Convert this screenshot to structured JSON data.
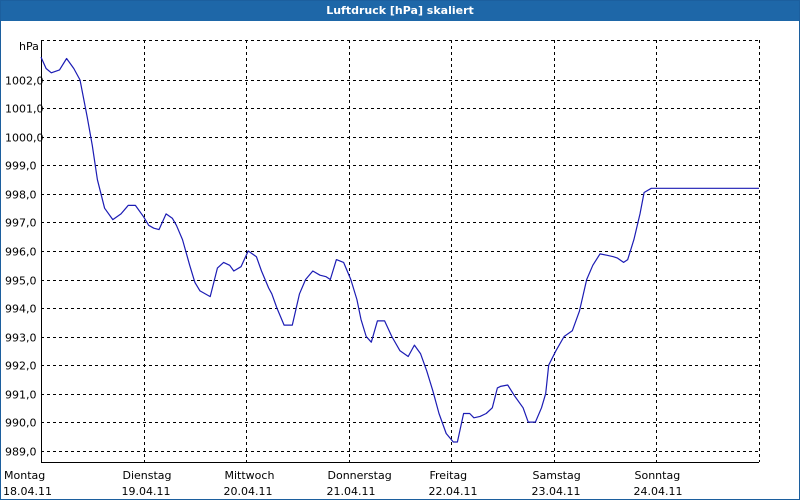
{
  "window": {
    "title": "Luftdruck [hPa] skaliert"
  },
  "chart_data": {
    "type": "line",
    "title": "Luftdruck [hPa] skaliert",
    "ylabel": "hPa",
    "xlabel": "",
    "ylim": [
      988.6,
      1003.4
    ],
    "xlim": [
      0,
      7
    ],
    "grid": true,
    "legend": "none",
    "line_color": "#1c1cb4",
    "grid_color": "#000000",
    "y_ticks": [
      "989,0",
      "990,0",
      "991,0",
      "992,0",
      "993,0",
      "994,0",
      "995,0",
      "996,0",
      "997,0",
      "998,0",
      "999,0",
      "1000,0",
      "1001,0",
      "1002,0"
    ],
    "y_tick_values": [
      989,
      990,
      991,
      992,
      993,
      994,
      995,
      996,
      997,
      998,
      999,
      1000,
      1001,
      1002
    ],
    "x_ticks": [
      {
        "x": 0,
        "day": "Montag",
        "date": "18.04.11"
      },
      {
        "x": 1,
        "day": "Dienstag",
        "date": "19.04.11"
      },
      {
        "x": 2,
        "day": "Mittwoch",
        "date": "20.04.11"
      },
      {
        "x": 3,
        "day": "Donnerstag",
        "date": "21.04.11"
      },
      {
        "x": 4,
        "day": "Freitag",
        "date": "22.04.11"
      },
      {
        "x": 5,
        "day": "Samstag",
        "date": "23.04.11"
      },
      {
        "x": 6,
        "day": "Sonntag",
        "date": "24.04.11"
      }
    ],
    "series": [
      {
        "name": "",
        "x": [
          0.0,
          0.05,
          0.1,
          0.18,
          0.25,
          0.32,
          0.38,
          0.45,
          0.5,
          0.55,
          0.62,
          0.7,
          0.78,
          0.85,
          0.92,
          1.0,
          1.05,
          1.1,
          1.15,
          1.22,
          1.28,
          1.32,
          1.38,
          1.45,
          1.5,
          1.55,
          1.65,
          1.72,
          1.78,
          1.84,
          1.88,
          1.95,
          2.02,
          2.1,
          2.15,
          2.22,
          2.25,
          2.3,
          2.37,
          2.45,
          2.52,
          2.58,
          2.65,
          2.72,
          2.78,
          2.82,
          2.88,
          2.95,
          3.02,
          3.08,
          3.12,
          3.17,
          3.22,
          3.28,
          3.35,
          3.42,
          3.5,
          3.58,
          3.64,
          3.7,
          3.76,
          3.82,
          3.88,
          3.95,
          4.02,
          4.06,
          4.12,
          4.18,
          4.22,
          4.28,
          4.34,
          4.4,
          4.45,
          4.48,
          4.55,
          4.62,
          4.7,
          4.75,
          4.82,
          4.88,
          4.92,
          4.95,
          5.02,
          5.1,
          5.18,
          5.25,
          5.32,
          5.38,
          5.45,
          5.52,
          5.58,
          5.62,
          5.68,
          5.72,
          5.78,
          5.84,
          5.88,
          5.95,
          6.02,
          6.08,
          6.12,
          6.2,
          6.28,
          6.36,
          6.44,
          6.52,
          6.6,
          6.65,
          6.7,
          6.75,
          6.82,
          6.88,
          6.92,
          6.95,
          7.0
        ],
        "values": [
          1002.8,
          1002.4,
          1002.25,
          1002.35,
          1002.75,
          1002.4,
          1002.0,
          1000.7,
          999.7,
          998.5,
          997.5,
          997.1,
          997.3,
          997.6,
          997.6,
          997.2,
          996.9,
          996.8,
          996.75,
          997.3,
          997.15,
          996.9,
          996.4,
          995.5,
          994.9,
          994.6,
          994.4,
          995.4,
          995.6,
          995.5,
          995.3,
          995.45,
          996.0,
          995.8,
          995.3,
          994.7,
          994.5,
          994.0,
          993.4,
          993.4,
          994.5,
          995.0,
          995.3,
          995.15,
          995.1,
          995.0,
          995.7,
          995.6,
          995.0,
          994.3,
          993.6,
          993.0,
          992.8,
          993.55,
          993.55,
          993.0,
          992.5,
          992.3,
          992.7,
          992.4,
          991.8,
          991.1,
          990.3,
          989.6,
          989.3,
          989.3,
          990.3,
          990.3,
          990.15,
          990.2,
          990.3,
          990.5,
          991.2,
          991.25,
          991.3,
          990.9,
          990.5,
          990.0,
          990.0,
          990.5,
          991.0,
          992.0,
          992.5,
          993.0,
          993.2,
          993.9,
          995.0,
          995.5,
          995.9,
          995.85,
          995.8,
          995.75,
          995.6,
          995.7,
          996.4,
          997.3,
          998.05,
          998.2,
          998.2,
          998.2,
          998.2,
          998.2,
          998.2,
          998.2,
          998.2,
          998.2,
          998.2,
          998.2,
          998.2,
          998.2,
          998.2,
          998.2,
          998.2,
          998.2,
          998.2
        ]
      }
    ]
  }
}
